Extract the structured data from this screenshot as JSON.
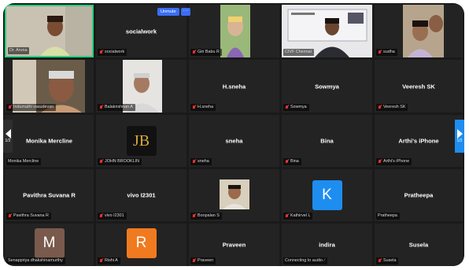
{
  "controls": {
    "unmute_label": "Unmute",
    "more_label": "···",
    "page_left": "1/2",
    "page_right": "1/2"
  },
  "tiles": [
    {
      "label": "Dr. Aruna",
      "muted": false
    },
    {
      "name": "socialwork",
      "label": "socialwork",
      "muted": true
    },
    {
      "label": "Giri Babu R",
      "muted": true
    },
    {
      "label": "CIVF Chennai",
      "muted": false
    },
    {
      "label": "sudha",
      "muted": true
    },
    {
      "label": "Indumathi vasudevan",
      "muted": true
    },
    {
      "label": "Balakrishnan A",
      "muted": true
    },
    {
      "name": "H.sneha",
      "label": "H.sneha",
      "muted": true
    },
    {
      "name": "Sowmya",
      "label": "Sowmya",
      "muted": true
    },
    {
      "name": "Veeresh SK",
      "label": "Veeresh SK",
      "muted": true
    },
    {
      "name": "Monika Mercline",
      "label": "Monika Mercline",
      "muted": false
    },
    {
      "label": "JOHN BROOKLIN",
      "muted": true,
      "avatar": "JB"
    },
    {
      "name": "sneha",
      "label": "sneha",
      "muted": true
    },
    {
      "name": "Bina",
      "label": "Bina",
      "muted": true
    },
    {
      "name": "Arthi's iPhone",
      "label": "Arthi's iPhone",
      "muted": true
    },
    {
      "name": "Pavithra Suvana R",
      "label": "Pavithra Suvana R",
      "muted": true
    },
    {
      "name": "vivo I2301",
      "label": "vivo I2301",
      "muted": true
    },
    {
      "label": "Boopalan S",
      "muted": true
    },
    {
      "label": "Kathirvel L",
      "muted": true,
      "avatar": "K"
    },
    {
      "name": "Pratheepa",
      "label": "Pratheepa",
      "muted": false
    },
    {
      "label": "Senappriya dhakshinamurthy",
      "muted": false,
      "avatar": "M"
    },
    {
      "label": "Rishi A",
      "muted": true,
      "avatar": "R"
    },
    {
      "name": "Praveen",
      "label": "Praveen",
      "muted": true
    },
    {
      "name": "indira",
      "label": "Connecting to audio",
      "muted": false
    },
    {
      "name": "Susela",
      "label": "Susela",
      "muted": true
    }
  ],
  "colors": {
    "active_border": "#26d07c",
    "avatar_m": "#7a5a4c",
    "avatar_r": "#f07a1f",
    "avatar_k": "#1e8df0",
    "unmute_bg": "#3b6ef5"
  }
}
